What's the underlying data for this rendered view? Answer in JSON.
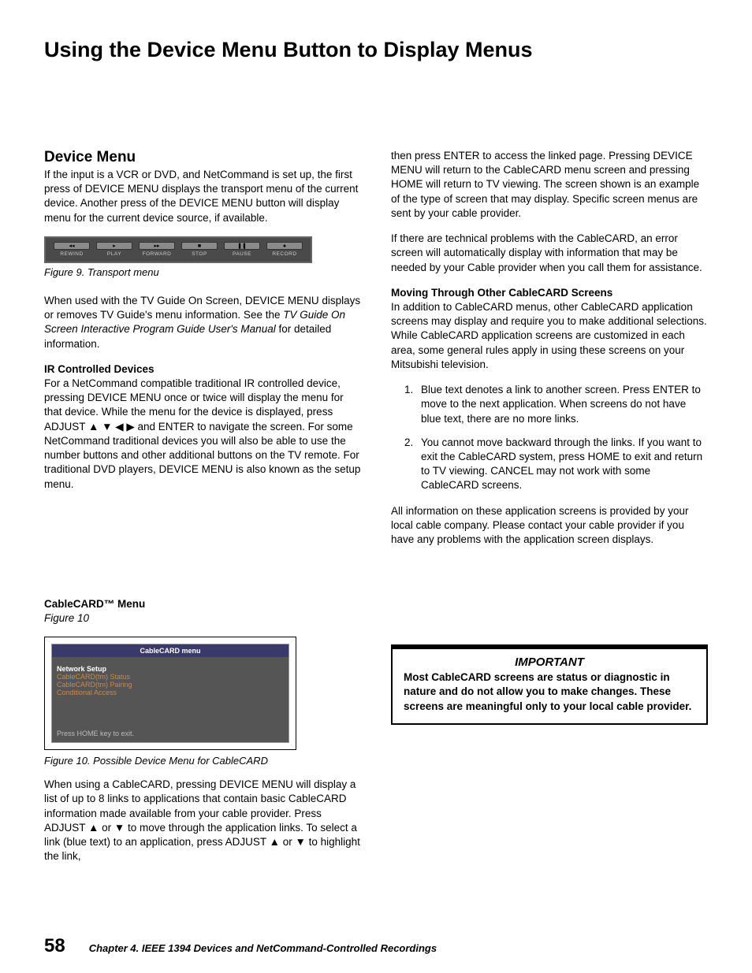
{
  "title": "Using the Device Menu Button to Display Menus",
  "left": {
    "h2": "Device Menu",
    "p1": "If the input is a VCR or DVD, and NetCommand is set up, the first press of DEVICE MENU displays the transport menu of the current device.  Another press of the DEVICE MENU button will display menu for the current device source, if available.",
    "transport_labels": [
      "REWIND",
      "PLAY",
      "FORWARD",
      "STOP",
      "PAUSE",
      "RECORD"
    ],
    "transport_icons": [
      "◂◂",
      "▸",
      "▸▸",
      "■",
      "❚❚",
      "●"
    ],
    "fig9": "Figure 9. Transport menu",
    "p2a": "When used with the TV Guide On Screen, DEVICE MENU displays or removes TV Guide's menu information.  See the ",
    "p2i": "TV Guide On Screen Interactive Program Guide User's Manual",
    "p2b": " for detailed information.",
    "sub1": "IR Controlled Devices",
    "p3": "For a NetCommand compatible traditional IR controlled device, pressing DEVICE MENU once or twice will display the menu for that device.  While the menu for the device is displayed, press ADJUST ▲ ▼ ◀ ▶ and ENTER to navigate the screen.  For some NetCommand traditional devices you will also be able to use the number buttons and other additional buttons on the TV remote. For traditional DVD players, DEVICE MENU is also known as the setup menu.",
    "ccard_head": "CableCARD™ Menu",
    "ccard_ref": "Figure 10",
    "ccard_title": "CableCARD menu",
    "ccard_first": "Network Setup",
    "ccard_items": [
      "CableCARD(tm) Status",
      "CableCARD(tm) Pairing",
      "Conditional Access"
    ],
    "ccard_foot": "Press HOME key to exit.",
    "fig10": "Figure 10. Possible Device Menu for CableCARD",
    "p4": "When using a CableCARD, pressing DEVICE MENU will display a list of up to 8 links to applications that contain basic CableCARD information made available from your cable provider.  Press ADJUST ▲ or ▼ to move through the application links.  To select a link (blue text) to an application, press ADJUST ▲ or ▼ to highlight the link,"
  },
  "right": {
    "p1": "then press ENTER to access the linked page.  Pressing DEVICE MENU will return to the CableCARD menu screen and pressing HOME will return to TV viewing.  The screen shown is an example of the type of screen that may display.  Specific screen menus are sent by your cable provider.",
    "p2": "If there are technical problems with the CableCARD, an error screen will automatically display with information that may be needed by your Cable provider when you call them for assistance.",
    "sub1": "Moving Through Other CableCARD Screens",
    "p3": "In addition to CableCARD menus, other CableCARD application screens may display and require you to make additional selections.  While CableCARD application screens are customized in each area, some general rules apply in using these screens on your Mitsubishi television.",
    "li1": "Blue text denotes a link to another screen. Press ENTER to move to the next application. When screens do not have blue text, there are no more links.",
    "li2": "You cannot move backward through the links.  If you want to exit the CableCARD system, press HOME to exit and return to TV viewing.  CANCEL may not work with some CableCARD screens.",
    "p4": "All information on these application screens is provided by your local cable company.  Please contact your cable provider if you have any problems with the application screen displays.",
    "imp_title": "IMPORTANT",
    "imp_body": "Most CableCARD screens are status or diagnostic in nature and do not allow you to make changes.  These screens are meaningful only to your local cable provider."
  },
  "footer": {
    "page": "58",
    "chapter": "Chapter 4. IEEE 1394 Devices and NetCommand-Controlled Recordings"
  }
}
